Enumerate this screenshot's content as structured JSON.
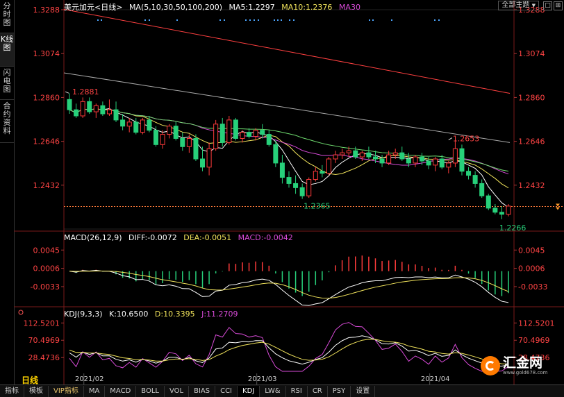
{
  "sidebar": {
    "items": [
      {
        "label": "分时图",
        "active": false
      },
      {
        "label": "K线图",
        "active": true
      },
      {
        "label": "闪电图",
        "active": false
      },
      {
        "label": "合约资料",
        "active": false
      }
    ]
  },
  "header": {
    "symbol": "美元加元<日线>",
    "ma_params": "MA(5,10,30,50,100,200)",
    "ma5": "MA5:1.2297",
    "ma10": "MA10:1.2376",
    "ma30": "MA30",
    "main_select": "全部主题",
    "main_select_arrow": "▼",
    "btn1": "□",
    "btn2": "⊞"
  },
  "macd": {
    "params": "MACD(26,12,9)",
    "diff": "DIFF:-0.0072",
    "dea": "DEA:-0.0051",
    "macd": "MACD:-0.0042"
  },
  "kdj": {
    "params": "KDJ(9,3,3)",
    "k": "K:10.6500",
    "d": "D:10.3395",
    "j": "J:11.2709"
  },
  "price_axis": {
    "left": [
      "1.3288",
      "1.3074",
      "1.2860",
      "1.2646",
      "1.2432"
    ],
    "right": [
      "1.3288",
      "1.3074",
      "1.2860",
      "1.2646",
      "1.2432"
    ]
  },
  "macd_axis": {
    "left": [
      "0.0045",
      "0.0006",
      "-0.0033"
    ],
    "right": [
      "0.0045",
      "0.0006",
      "-0.0033"
    ]
  },
  "kdj_axis": {
    "left": [
      "112.5201",
      "70.4969",
      "28.4736"
    ],
    "right": [
      "112.5201",
      "70.4969",
      "28.4736"
    ]
  },
  "annotations": {
    "high1": "1.2881",
    "low1": "1.2365",
    "high2": "1.2653",
    "low2": "1.2266"
  },
  "dates": [
    "2021/02",
    "2021/03",
    "2021/04"
  ],
  "period": "日线",
  "toolbar": {
    "items": [
      "指标",
      "模板",
      "VIP指标",
      "MA",
      "MACD",
      "BOLL",
      "VOL",
      "BIAS",
      "CCI",
      "KDJ",
      "LW&",
      "RSI",
      "CR",
      "PSY",
      "设置"
    ]
  },
  "logo": {
    "cn": "汇金网",
    "url": "www.gold678.com"
  },
  "colors": {
    "up": "#ff3b3b",
    "down": "#27d07a",
    "ma5": "#ffffff",
    "ma10": "#f2e45c",
    "ma30": "#d94bd9",
    "ma50": "#6fdc6f",
    "ma100": "#aaaaaa",
    "ma200": "#ff4040",
    "gold": "#e8c36a"
  },
  "chart_data": {
    "type": "candlestick",
    "series": [
      {
        "name": "MA5",
        "value": 1.2297
      },
      {
        "name": "MA10",
        "value": 1.2376
      }
    ],
    "ohlc": [
      [
        1.285,
        1.2881,
        1.278,
        1.28
      ],
      [
        1.28,
        1.283,
        1.276,
        1.277
      ],
      [
        1.277,
        1.286,
        1.276,
        1.284
      ],
      [
        1.284,
        1.286,
        1.278,
        1.279
      ],
      [
        1.279,
        1.283,
        1.276,
        1.282
      ],
      [
        1.282,
        1.284,
        1.277,
        1.278
      ],
      [
        1.278,
        1.285,
        1.277,
        1.28
      ],
      [
        1.28,
        1.284,
        1.274,
        1.275
      ],
      [
        1.275,
        1.278,
        1.27,
        1.272
      ],
      [
        1.272,
        1.276,
        1.269,
        1.274
      ],
      [
        1.274,
        1.276,
        1.268,
        1.269
      ],
      [
        1.269,
        1.276,
        1.268,
        1.275
      ],
      [
        1.275,
        1.277,
        1.269,
        1.27
      ],
      [
        1.27,
        1.272,
        1.262,
        1.263
      ],
      [
        1.263,
        1.27,
        1.261,
        1.268
      ],
      [
        1.268,
        1.273,
        1.266,
        1.272
      ],
      [
        1.272,
        1.274,
        1.265,
        1.266
      ],
      [
        1.266,
        1.269,
        1.26,
        1.262
      ],
      [
        1.262,
        1.268,
        1.259,
        1.266
      ],
      [
        1.266,
        1.268,
        1.255,
        1.256
      ],
      [
        1.256,
        1.262,
        1.25,
        1.252
      ],
      [
        1.252,
        1.264,
        1.248,
        1.261
      ],
      [
        1.261,
        1.275,
        1.26,
        1.273
      ],
      [
        1.273,
        1.276,
        1.262,
        1.264
      ],
      [
        1.264,
        1.277,
        1.263,
        1.275
      ],
      [
        1.275,
        1.276,
        1.265,
        1.266
      ],
      [
        1.266,
        1.27,
        1.264,
        1.269
      ],
      [
        1.269,
        1.271,
        1.266,
        1.267
      ],
      [
        1.267,
        1.271,
        1.265,
        1.27
      ],
      [
        1.27,
        1.273,
        1.266,
        1.268
      ],
      [
        1.268,
        1.27,
        1.262,
        1.263
      ],
      [
        1.263,
        1.265,
        1.252,
        1.254
      ],
      [
        1.254,
        1.258,
        1.244,
        1.247
      ],
      [
        1.247,
        1.25,
        1.242,
        1.244
      ],
      [
        1.244,
        1.248,
        1.239,
        1.242
      ],
      [
        1.242,
        1.244,
        1.2365,
        1.238
      ],
      [
        1.238,
        1.247,
        1.237,
        1.246
      ],
      [
        1.246,
        1.252,
        1.245,
        1.25
      ],
      [
        1.25,
        1.253,
        1.247,
        1.249
      ],
      [
        1.249,
        1.257,
        1.248,
        1.256
      ],
      [
        1.256,
        1.26,
        1.254,
        1.258
      ],
      [
        1.258,
        1.261,
        1.256,
        1.259
      ],
      [
        1.259,
        1.262,
        1.257,
        1.26
      ],
      [
        1.26,
        1.262,
        1.256,
        1.257
      ],
      [
        1.257,
        1.26,
        1.255,
        1.259
      ],
      [
        1.259,
        1.262,
        1.256,
        1.257
      ],
      [
        1.257,
        1.26,
        1.254,
        1.256
      ],
      [
        1.256,
        1.258,
        1.252,
        1.254
      ],
      [
        1.254,
        1.26,
        1.253,
        1.258
      ],
      [
        1.258,
        1.261,
        1.256,
        1.259
      ],
      [
        1.259,
        1.262,
        1.255,
        1.256
      ],
      [
        1.256,
        1.259,
        1.252,
        1.254
      ],
      [
        1.254,
        1.258,
        1.252,
        1.257
      ],
      [
        1.257,
        1.259,
        1.253,
        1.255
      ],
      [
        1.255,
        1.257,
        1.251,
        1.253
      ],
      [
        1.253,
        1.257,
        1.25,
        1.256
      ],
      [
        1.256,
        1.258,
        1.251,
        1.252
      ],
      [
        1.252,
        1.255,
        1.249,
        1.254
      ],
      [
        1.254,
        1.2653,
        1.252,
        1.261
      ],
      [
        1.261,
        1.263,
        1.248,
        1.25
      ],
      [
        1.25,
        1.252,
        1.246,
        1.248
      ],
      [
        1.248,
        1.25,
        1.242,
        1.244
      ],
      [
        1.244,
        1.246,
        1.237,
        1.238
      ],
      [
        1.238,
        1.239,
        1.231,
        1.232
      ],
      [
        1.232,
        1.234,
        1.229,
        1.23
      ],
      [
        1.23,
        1.233,
        1.2266,
        1.229
      ],
      [
        1.229,
        1.234,
        1.228,
        1.233
      ]
    ]
  }
}
